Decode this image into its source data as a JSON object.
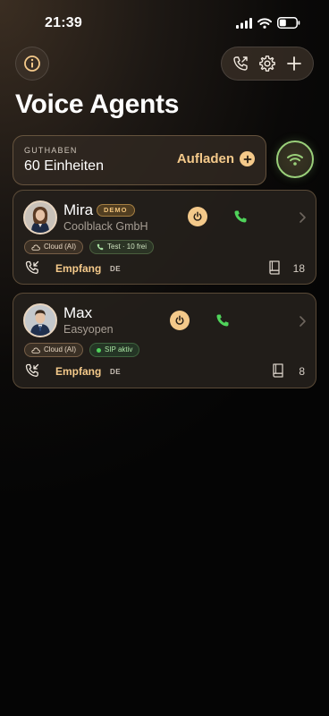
{
  "status_bar": {
    "time": "21:39"
  },
  "header": {
    "title": "Voice Agents"
  },
  "credits": {
    "label": "GUTHABEN",
    "value": "60 Einheiten",
    "topup_label": "Aufladen"
  },
  "agents": [
    {
      "name": "Mira",
      "badge": "DEMO",
      "company": "Coolblack GmbH",
      "tags": [
        "Cloud (AI)",
        "Test · 10 frei"
      ],
      "mode": "Empfang",
      "language": "DE",
      "knowledge_count": "18"
    },
    {
      "name": "Max",
      "company": "Easyopen",
      "tags": [
        "Cloud (AI)",
        "SIP aktiv"
      ],
      "mode": "Empfang",
      "language": "DE",
      "knowledge_count": "8"
    }
  ],
  "colors": {
    "accent": "#f4c98a",
    "live_green": "#9ad07a",
    "phone_green": "#4fd35a"
  },
  "icons": [
    "info-icon",
    "call-log-icon",
    "gear-icon",
    "plus-icon",
    "wifi-icon",
    "power-icon",
    "phone-icon",
    "chevron-right-icon",
    "cloud-icon",
    "incoming-call-icon",
    "book-icon"
  ]
}
